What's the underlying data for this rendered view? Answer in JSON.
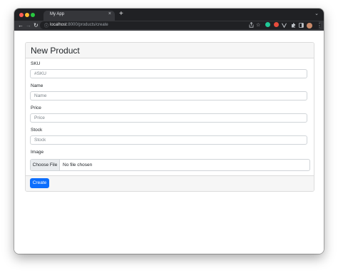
{
  "browser": {
    "tab": {
      "title": "My App",
      "close": "×"
    },
    "new_tab": "+",
    "menu": "⌄",
    "nav": {
      "back": "←",
      "forward": "→",
      "reload": "↻"
    },
    "address": {
      "lock": "ⓘ",
      "host": "localhost",
      "path": ":8000/products/create"
    },
    "toolbar_icons": [
      "share-icon",
      "bookmark-star-icon",
      "extension-green-icon",
      "extension-red-icon",
      "extension-v-icon",
      "puzzle-icon",
      "side-panel-icon",
      "profile-avatar",
      "kebab-menu-icon"
    ]
  },
  "colors": {
    "primary": "#0d6efd",
    "card_header_bg": "#f6f6f6",
    "chrome_dark": "#202124"
  },
  "form": {
    "title": "New Product",
    "fields": {
      "sku": {
        "label": "SKU",
        "placeholder": "#SKU",
        "value": ""
      },
      "name": {
        "label": "Name",
        "placeholder": "Name",
        "value": ""
      },
      "price": {
        "label": "Price",
        "placeholder": "Price",
        "value": ""
      },
      "stock": {
        "label": "Stock",
        "placeholder": "Stock",
        "value": ""
      }
    },
    "image": {
      "label": "Image",
      "button": "Choose File",
      "status": "No file chosen"
    },
    "submit": "Create"
  }
}
